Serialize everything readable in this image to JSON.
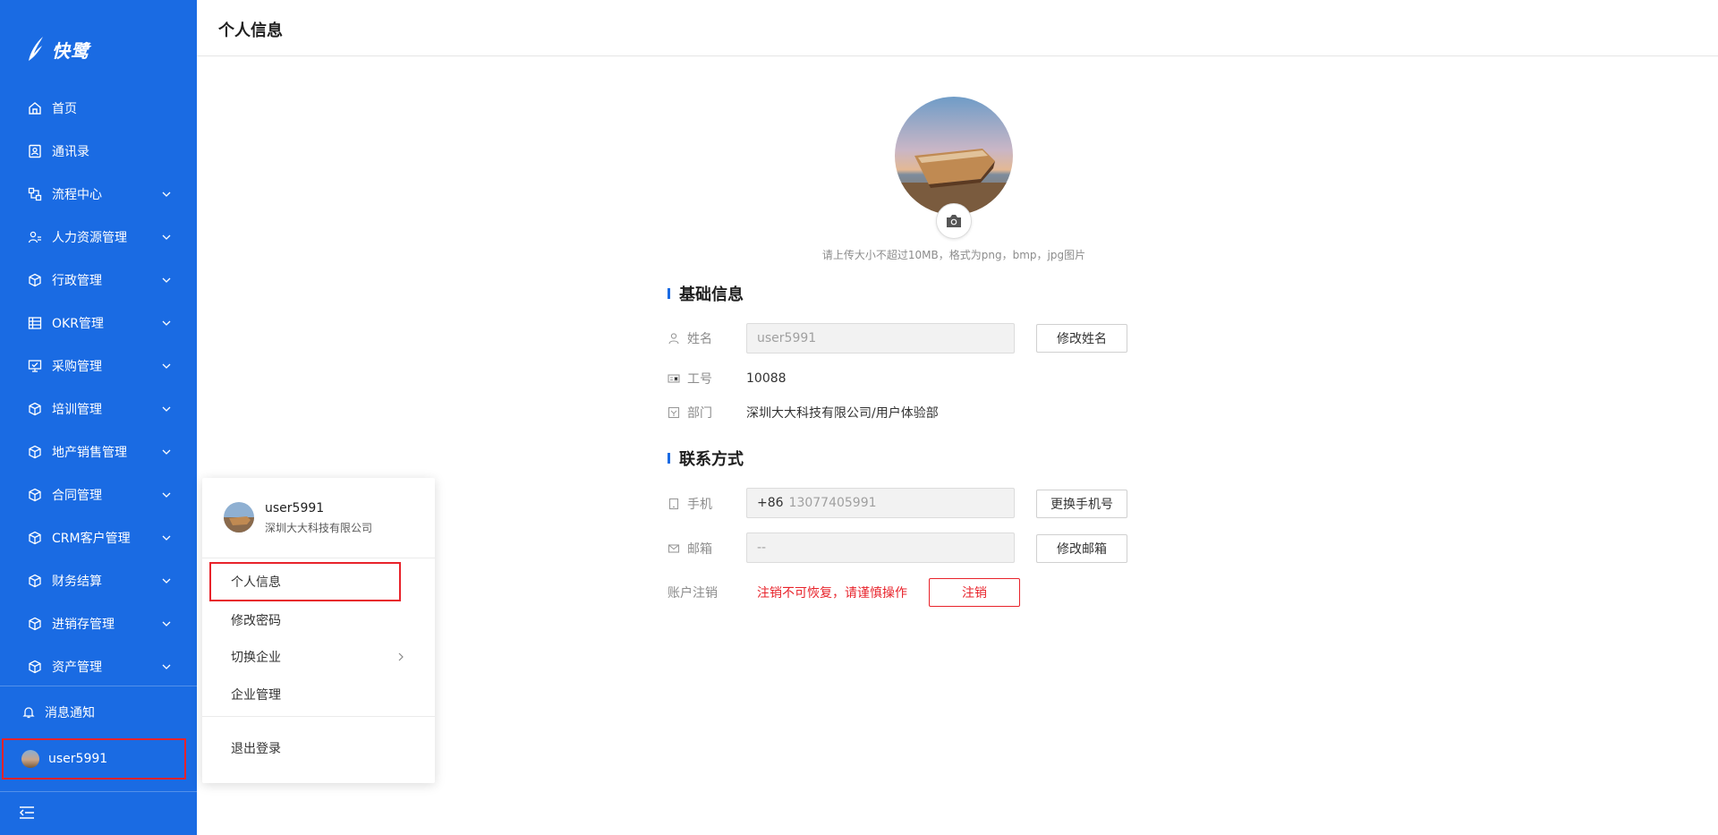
{
  "app": {
    "brand": "快鹭",
    "brand_color": "#1a6be3"
  },
  "sidebar": {
    "items": [
      {
        "label": "首页",
        "icon": "home-icon",
        "expandable": false
      },
      {
        "label": "通讯录",
        "icon": "contacts-icon",
        "expandable": false
      },
      {
        "label": "流程中心",
        "icon": "workflow-icon",
        "expandable": true
      },
      {
        "label": "人力资源管理",
        "icon": "people-icon",
        "expandable": true
      },
      {
        "label": "行政管理",
        "icon": "cube-icon",
        "expandable": true
      },
      {
        "label": "OKR管理",
        "icon": "table-icon",
        "expandable": true
      },
      {
        "label": "采购管理",
        "icon": "monitor-icon",
        "expandable": true
      },
      {
        "label": "培训管理",
        "icon": "cube-icon",
        "expandable": true
      },
      {
        "label": "地产销售管理",
        "icon": "cube-icon",
        "expandable": true
      },
      {
        "label": "合同管理",
        "icon": "cube-icon",
        "expandable": true
      },
      {
        "label": "CRM客户管理",
        "icon": "cube-icon",
        "expandable": true
      },
      {
        "label": "财务结算",
        "icon": "cube-icon",
        "expandable": true
      },
      {
        "label": "进销存管理",
        "icon": "cube-icon",
        "expandable": true
      },
      {
        "label": "资产管理",
        "icon": "cube-icon",
        "expandable": true
      }
    ],
    "notify_label": "消息通知",
    "user_label": "user5991"
  },
  "header": {
    "title": "个人信息"
  },
  "profile": {
    "upload_hint": "请上传大小不超过10MB，格式为png，bmp，jpg图片",
    "basic_title": "基础信息",
    "name_label": "姓名",
    "name_value": "user5991",
    "rename_button": "修改姓名",
    "id_label": "工号",
    "id_value": "10088",
    "dept_label": "部门",
    "dept_value": "深圳大大科技有限公司/用户体验部",
    "contact_title": "联系方式",
    "phone_label": "手机",
    "phone_prefix": "+86",
    "phone_value": "13077405991",
    "change_phone_button": "更换手机号",
    "email_label": "邮箱",
    "email_value": "--",
    "change_email_button": "修改邮箱",
    "cancel_label": "账户注销",
    "cancel_warning": "注销不可恢复，请谨慎操作",
    "cancel_button": "注销",
    "danger_color": "#e8232b"
  },
  "popup": {
    "name": "user5991",
    "company": "深圳大大科技有限公司",
    "items": {
      "profile": "个人信息",
      "password": "修改密码",
      "switch_company": "切换企业",
      "company_mgmt": "企业管理",
      "logout": "退出登录"
    }
  }
}
